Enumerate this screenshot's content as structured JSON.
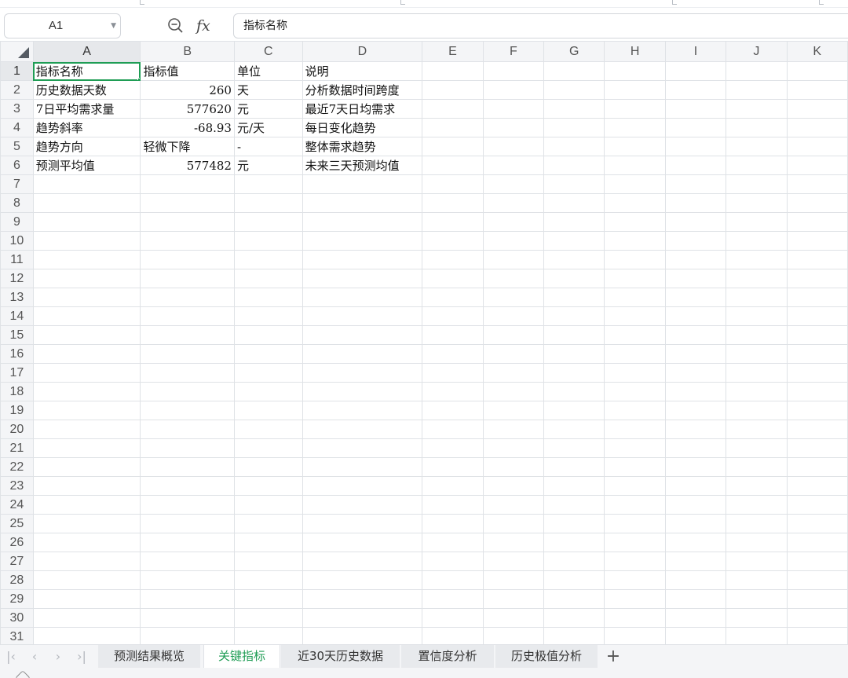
{
  "formula_bar": {
    "name_box": "A1",
    "fx_label": "fx",
    "content": "指标名称"
  },
  "columns": [
    "A",
    "B",
    "C",
    "D",
    "E",
    "F",
    "G",
    "H",
    "I",
    "J",
    "K"
  ],
  "rows": [
    "1",
    "2",
    "3",
    "4",
    "5",
    "6",
    "7",
    "8",
    "9",
    "10",
    "11",
    "12",
    "13",
    "14",
    "15",
    "16",
    "17",
    "18",
    "19",
    "20",
    "21",
    "22",
    "23",
    "24",
    "25",
    "26",
    "27",
    "28",
    "29",
    "30",
    "31"
  ],
  "cells": [
    [
      "指标名称",
      "指标值",
      "单位",
      "说明"
    ],
    [
      "历史数据天数",
      "260",
      "天",
      "分析数据时间跨度"
    ],
    [
      "7日平均需求量",
      "577620",
      "元",
      "最近7天日均需求"
    ],
    [
      "趋势斜率",
      "-68.93",
      "元/天",
      "每日变化趋势"
    ],
    [
      "趋势方向",
      "轻微下降",
      "-",
      "整体需求趋势"
    ],
    [
      "预测平均值",
      "577482",
      "元",
      "未来三天预测均值"
    ]
  ],
  "sheet_tabs": [
    {
      "label": "预测结果概览",
      "active": false
    },
    {
      "label": "关键指标",
      "active": true
    },
    {
      "label": "近30天历史数据",
      "active": false
    },
    {
      "label": "置信度分析",
      "active": false
    },
    {
      "label": "历史极值分析",
      "active": false
    }
  ],
  "add_sheet": "+",
  "accent_color": "#1f9d55"
}
